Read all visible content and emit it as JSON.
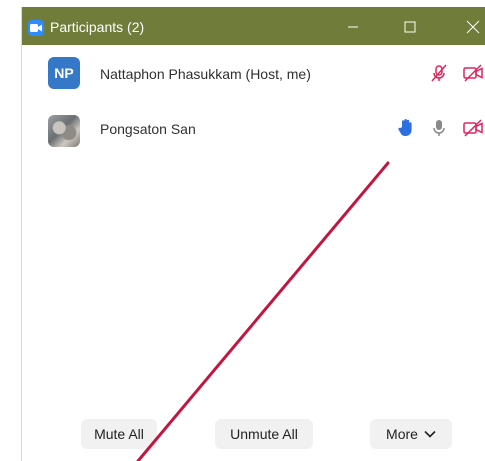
{
  "window": {
    "title": "Participants (2)"
  },
  "participants": [
    {
      "initials": "NP",
      "name": "Nattaphon Phasukkam (Host, me)"
    },
    {
      "name": "Pongsaton San"
    }
  ],
  "buttons": {
    "mute_all": "Mute All",
    "unmute_all": "Unmute All",
    "more": "More"
  },
  "colors": {
    "titlebar": "#6f7c3a",
    "accent_blue": "#2d8cff",
    "muted_red": "#e0245e",
    "annotation_line": "#c4153f"
  },
  "icons": [
    "video-app-icon",
    "minimize-icon",
    "maximize-icon",
    "close-icon",
    "mic-muted-icon",
    "video-off-icon",
    "raised-hand-icon",
    "mic-icon",
    "chevron-down-icon"
  ]
}
